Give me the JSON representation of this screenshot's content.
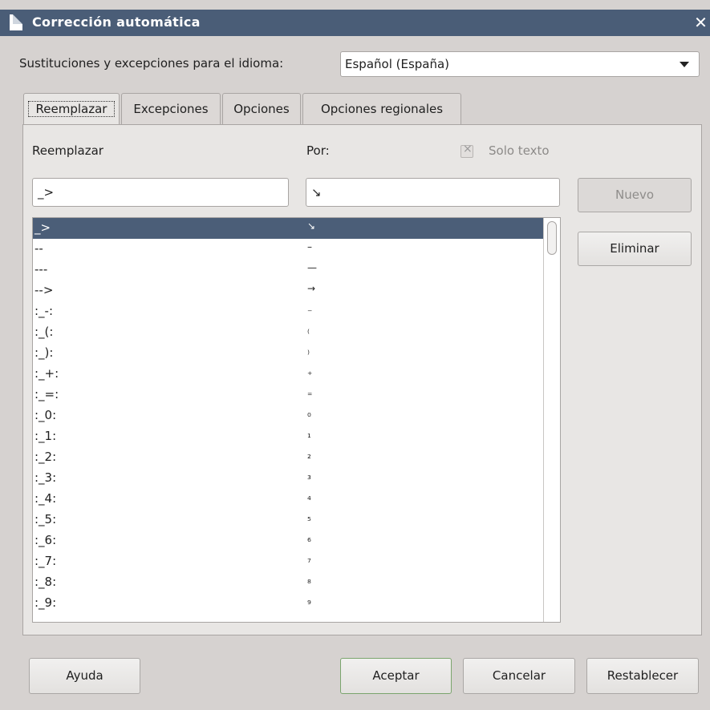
{
  "window": {
    "title": "Corrección automática",
    "close_glyph": "✕"
  },
  "language": {
    "label": "Sustituciones y excepciones para el idioma:",
    "selected": "Español (España)"
  },
  "tabs": [
    {
      "label": "Reemplazar",
      "active": true
    },
    {
      "label": "Excepciones",
      "active": false
    },
    {
      "label": "Opciones",
      "active": false
    },
    {
      "label": "Opciones regionales",
      "active": false
    }
  ],
  "replace": {
    "replace_label": "Reemplazar",
    "with_label": "Por:",
    "text_only_label": "Solo texto",
    "text_only_checked": true,
    "replace_value": "_>",
    "with_value": "↘",
    "new_button": "Nuevo",
    "delete_button": "Eliminar"
  },
  "entries": [
    {
      "from": "_>",
      "to": "↘",
      "selected": true
    },
    {
      "from": "--",
      "to": "–"
    },
    {
      "from": "---",
      "to": "—"
    },
    {
      "from": "-->",
      "to": "→"
    },
    {
      "from": ":_-:",
      "to": "₋"
    },
    {
      "from": ":_(:",
      "to": "₍"
    },
    {
      "from": ":_):",
      "to": "₎"
    },
    {
      "from": ":_+:",
      "to": "₊"
    },
    {
      "from": ":_=:",
      "to": "₌"
    },
    {
      "from": ":_0:",
      "to": "₀"
    },
    {
      "from": ":_1:",
      "to": "₁"
    },
    {
      "from": ":_2:",
      "to": "₂"
    },
    {
      "from": ":_3:",
      "to": "₃"
    },
    {
      "from": ":_4:",
      "to": "₄"
    },
    {
      "from": ":_5:",
      "to": "₅"
    },
    {
      "from": ":_6:",
      "to": "₆"
    },
    {
      "from": ":_7:",
      "to": "₇"
    },
    {
      "from": ":_8:",
      "to": "₈"
    },
    {
      "from": ":_9:",
      "to": "₉"
    }
  ],
  "footer": {
    "help": "Ayuda",
    "ok": "Aceptar",
    "cancel": "Cancelar",
    "reset": "Restablecer"
  },
  "colors": {
    "titlebar": "#4a5d77",
    "selection": "#4b5e78",
    "background": "#d6d2d0"
  }
}
